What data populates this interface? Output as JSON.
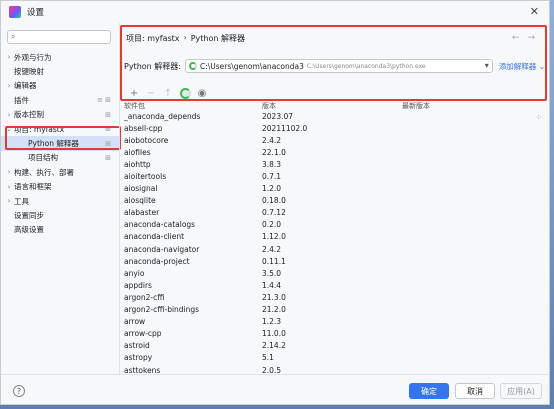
{
  "window": {
    "title": "设置",
    "close_glyph": "✕"
  },
  "search": {
    "icon": "search-icon",
    "glyph": "⌕",
    "value": ""
  },
  "sidebar": {
    "items": [
      {
        "label": "外观与行为",
        "arrow": "›",
        "mark": ""
      },
      {
        "label": "按键映射",
        "arrow": "",
        "mark": ""
      },
      {
        "label": "编辑器",
        "arrow": "›",
        "mark": ""
      },
      {
        "label": "插件",
        "arrow": "",
        "mark": "≡ ⊞"
      },
      {
        "label": "版本控制",
        "arrow": "›",
        "mark": "⊞"
      },
      {
        "label": "项目: myfastx",
        "arrow": "⌄",
        "mark": "⊞"
      },
      {
        "label": "Python 解释器",
        "arrow": "",
        "mark": "⊞"
      },
      {
        "label": "项目结构",
        "arrow": "",
        "mark": "⊞"
      },
      {
        "label": "构建、执行、部署",
        "arrow": "›",
        "mark": ""
      },
      {
        "label": "语言和框架",
        "arrow": "›",
        "mark": ""
      },
      {
        "label": "工具",
        "arrow": "›",
        "mark": ""
      },
      {
        "label": "设置同步",
        "arrow": "",
        "mark": ""
      },
      {
        "label": "高级设置",
        "arrow": "",
        "mark": ""
      }
    ]
  },
  "breadcrumb": {
    "project": "项目: myfastx",
    "sep": "›",
    "page": "Python 解释器"
  },
  "nav": {
    "back": "←",
    "forward": "→"
  },
  "interpreter": {
    "label": "Python 解释器:",
    "name": "C:\\Users\\genom\\anaconda3",
    "path": "C:\\Users\\genom\\anaconda3\\python.exe",
    "dropdown_glyph": "▾",
    "add_label": "添加解释器",
    "add_arrow": "⌄"
  },
  "toolbar": {
    "add": "+",
    "remove": "−",
    "upgrade": "↑",
    "eye": "◉"
  },
  "table": {
    "headers": [
      "软件包",
      "版本",
      "最新版本"
    ],
    "rows": [
      [
        "_anaconda_depends",
        "2023.07",
        ""
      ],
      [
        "absell-cpp",
        "20211102.0",
        ""
      ],
      [
        "aiobotocore",
        "2.4.2",
        ""
      ],
      [
        "aiofiles",
        "22.1.0",
        ""
      ],
      [
        "aiohttp",
        "3.8.3",
        ""
      ],
      [
        "aioitertools",
        "0.7.1",
        ""
      ],
      [
        "aiosignal",
        "1.2.0",
        ""
      ],
      [
        "aiosqlite",
        "0.18.0",
        ""
      ],
      [
        "alabaster",
        "0.7.12",
        ""
      ],
      [
        "anaconda-catalogs",
        "0.2.0",
        ""
      ],
      [
        "anaconda-client",
        "1.12.0",
        ""
      ],
      [
        "anaconda-navigator",
        "2.4.2",
        ""
      ],
      [
        "anaconda-project",
        "0.11.1",
        ""
      ],
      [
        "anyio",
        "3.5.0",
        ""
      ],
      [
        "appdirs",
        "1.4.4",
        ""
      ],
      [
        "argon2-cffi",
        "21.3.0",
        ""
      ],
      [
        "argon2-cffi-bindings",
        "21.2.0",
        ""
      ],
      [
        "arrow",
        "1.2.3",
        ""
      ],
      [
        "arrow-cpp",
        "11.0.0",
        ""
      ],
      [
        "astroid",
        "2.14.2",
        ""
      ],
      [
        "astropy",
        "5.1",
        ""
      ],
      [
        "asttokens",
        "2.0.5",
        ""
      ]
    ]
  },
  "footer": {
    "help": "?",
    "ok": "确定",
    "cancel": "取消",
    "apply": "应用(A)"
  }
}
